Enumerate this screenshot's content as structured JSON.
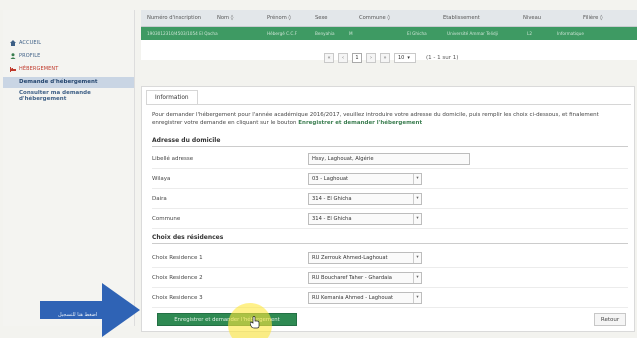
{
  "sidebar": {
    "accueil": "ACCUEIL",
    "profile": "PROFILE",
    "hebergement": "HÉBERGEMENT",
    "sub_items": [
      {
        "label": "Demande d'hébergement"
      },
      {
        "label": "Consulter ma demande d'hébergement"
      }
    ]
  },
  "grid": {
    "columns": [
      "Numéro d'inscription",
      "Nom ◊",
      "Prénom ◊",
      "Sexe",
      "Commune ◊",
      "Etablissement",
      "Niveau",
      "Filière ◊"
    ],
    "row": [
      "1903012310/4503/1054 El Qacha",
      "Hébergé C.C.F",
      "Benyahia",
      "M",
      "El Ghicha",
      "Université Ammar Telidji",
      "L2",
      "Informatique"
    ],
    "pager": {
      "first": "«",
      "prev": "‹",
      "page": "1",
      "next": "›",
      "last": "»",
      "rows": "10",
      "count": "(1 - 1 sur 1)"
    }
  },
  "form": {
    "tab": "Information",
    "intro_text": "Pour demander l'hébergement pour l'année académique 2016/2017, veuillez introduire votre adresse du domicile, puis remplir les choix ci-dessous, et finalement enregistrer votre demande en cliquant sur le bouton ",
    "intro_link": "Enregistrer et demander l'hébergement",
    "section_address": "Adresse du domicile",
    "section_residences": "Choix des résidences",
    "address": {
      "label": "Libellé adresse",
      "value": "Hssy, Laghouat, Algérie"
    },
    "wilaya": {
      "label": "Wilaya",
      "value": "03 - Laghouat"
    },
    "daira": {
      "label": "Daira",
      "value": "314 - El Ghicha"
    },
    "commune": {
      "label": "Commune",
      "value": "314 - El Ghicha"
    },
    "choix1": {
      "label": "Choix Residence 1",
      "value": "RU Zerrouk Ahmed-Laghouat"
    },
    "choix2": {
      "label": "Choix Residence 2",
      "value": "RU Boucharef Taher - Ghardaia"
    },
    "choix3": {
      "label": "Choix Residence 3",
      "value": "RU Kemania Ahmed - Laghouat"
    },
    "save_button": "Enregistrer et demander l'hébergement",
    "back_button": "Retour"
  },
  "overlay": {
    "arrow_text": "اضغط هنا للتسجيل"
  },
  "colors": {
    "green": "#2f8a53",
    "sidebar_active": "#c9d5e4",
    "link": "#3d5f86"
  }
}
